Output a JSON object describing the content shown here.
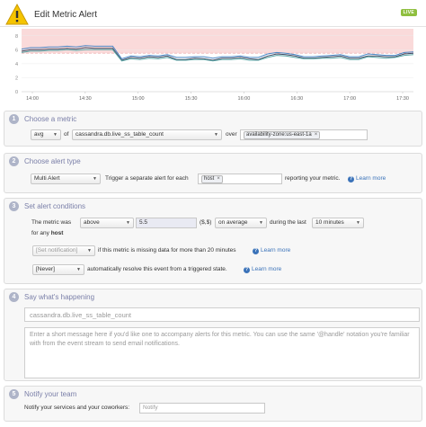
{
  "header": {
    "title": "Edit Metric Alert",
    "badge": "LIVE",
    "icon": "warning-icon"
  },
  "chart_data": {
    "type": "line",
    "x_ticks": [
      "14:00",
      "14:30",
      "15:00",
      "15:30",
      "16:00",
      "16:30",
      "17:00",
      "17:30"
    ],
    "y_ticks": [
      0,
      2,
      4,
      6,
      8
    ],
    "ylim": [
      0,
      9
    ],
    "threshold": 5.5,
    "threshold_color": "#fadada",
    "series": [
      {
        "color": "#4a86c5",
        "values": [
          6.1,
          6.3,
          6.3,
          6.4,
          6.4,
          6.5,
          6.4,
          6.6,
          6.5,
          6.5,
          6.5,
          4.7,
          5.1,
          5.0,
          5.2,
          5.1,
          5.3,
          4.9,
          4.9,
          5.0,
          5.0,
          4.8,
          5.0,
          5.0,
          5.1,
          4.9,
          4.9,
          5.4,
          5.6,
          5.5,
          5.3,
          5.0,
          5.0,
          5.1,
          5.2,
          5.3,
          5.0,
          5.0,
          5.4,
          5.3,
          5.2,
          5.2,
          5.6,
          5.7
        ]
      },
      {
        "color": "#3f4a63",
        "values": [
          5.8,
          6.0,
          6.0,
          6.1,
          6.1,
          6.2,
          6.1,
          6.3,
          6.2,
          6.2,
          6.2,
          4.5,
          4.9,
          4.8,
          5.0,
          4.9,
          5.1,
          4.6,
          4.6,
          4.8,
          4.7,
          4.5,
          4.8,
          4.8,
          4.9,
          4.7,
          4.6,
          5.1,
          5.4,
          5.3,
          5.1,
          4.8,
          4.8,
          4.9,
          5.0,
          5.1,
          4.8,
          4.8,
          5.1,
          5.1,
          5.0,
          5.0,
          5.4,
          5.5
        ]
      },
      {
        "color": "#5aa6a6",
        "values": [
          5.6,
          5.8,
          5.8,
          5.9,
          5.9,
          6.0,
          5.9,
          6.0,
          6.0,
          6.0,
          6.0,
          4.4,
          4.7,
          4.6,
          4.8,
          4.7,
          4.9,
          4.5,
          4.5,
          4.6,
          4.6,
          4.4,
          4.6,
          4.6,
          4.7,
          4.5,
          4.5,
          4.9,
          5.2,
          5.1,
          4.9,
          4.7,
          4.7,
          4.8,
          4.8,
          4.9,
          4.6,
          4.6,
          5.0,
          4.9,
          4.8,
          4.9,
          5.2,
          5.3
        ]
      }
    ]
  },
  "sections": {
    "metric": {
      "num": "1",
      "title": "Choose a metric",
      "agg": "avg",
      "of": "of",
      "metric": "cassandra.db.live_ss_table_count",
      "over": "over",
      "scope_tag": "availability-zone:us-east-1a",
      "tag_close": "×"
    },
    "alert_type": {
      "num": "2",
      "title": "Choose alert type",
      "type": "Multi Alert",
      "trigger_text": "Trigger a separate alert for each",
      "host_tag": "host",
      "tag_close": "×",
      "report_text": "reporting your metric.",
      "learn_more": "Learn more"
    },
    "conditions": {
      "num": "3",
      "title": "Set alert conditions",
      "metric_was": "The metric was",
      "comparator": "above",
      "threshold": "5.5",
      "unit": "($,$)",
      "window_mode": "on average",
      "during": "during the last",
      "window": "10 minutes",
      "for_any": "for any",
      "for_any_bold": "host",
      "notify_select": "[Set notification]",
      "missing_text": "if this metric is missing data for more than 20 minutes",
      "learn_more_1": "Learn more",
      "resolve_select": "[Never]",
      "resolve_text": "automatically resolve this event from a triggered state.",
      "learn_more_2": "Learn more"
    },
    "message": {
      "num": "4",
      "title": "Say what's happening",
      "subject_placeholder": "cassandra.db.live_ss_table_count",
      "body_placeholder": "Enter a short message here if you'd like one to accompany alerts for this metric. You can use the same '@handle' notation you're familiar with from the event stream to send email notifications."
    },
    "notify": {
      "num": "5",
      "title": "Notify your team",
      "label": "Notify your services and your coworkers:",
      "placeholder": "Notify"
    }
  }
}
